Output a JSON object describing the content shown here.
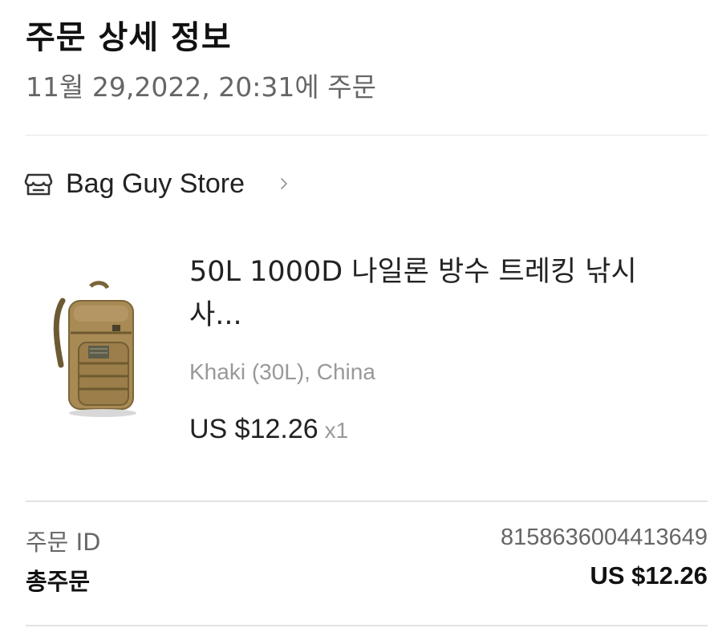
{
  "header": {
    "title": "주문 상세 정보",
    "order_time": "11월 29,2022, 20:31에 주문"
  },
  "store": {
    "name": "Bag Guy Store",
    "icon": "storefront-icon",
    "chevron_icon": "chevron-right-icon"
  },
  "product": {
    "title_line1": "50L 1000D 나일론 방수 트레킹 낚시",
    "title_line2": "사...",
    "variant": "Khaki (30L), China",
    "price": "US $12.26",
    "quantity": "x1",
    "image_icon": "backpack-image"
  },
  "summary": {
    "order_id_label": "주문 ID",
    "order_id_value": "8158636004413649",
    "total_label": "총주문",
    "total_value": "US $12.26"
  },
  "colors": {
    "text_primary": "#222222",
    "text_secondary": "#666666",
    "text_muted": "#999999",
    "divider": "#e6e6e6"
  }
}
